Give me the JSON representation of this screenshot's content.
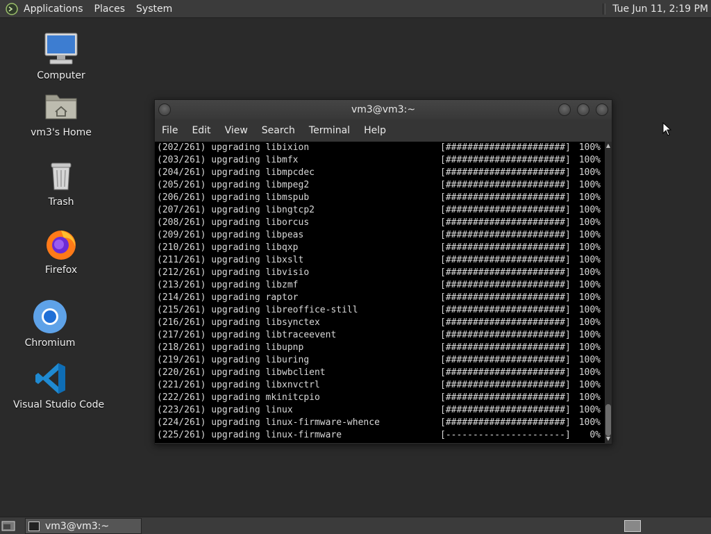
{
  "top_panel": {
    "menus": [
      "Applications",
      "Places",
      "System"
    ],
    "clock": "Tue Jun 11,  2:19 PM"
  },
  "desktop_icons": [
    {
      "label": "Computer",
      "icon": "computer-icon"
    },
    {
      "label": "vm3's Home",
      "icon": "home-folder-icon"
    },
    {
      "label": "Trash",
      "icon": "trash-icon"
    },
    {
      "label": "Firefox",
      "icon": "firefox-icon"
    },
    {
      "label": "Chromium",
      "icon": "chromium-icon"
    },
    {
      "label": "Visual Studio Code",
      "icon": "vscode-icon"
    }
  ],
  "terminal": {
    "title": "vm3@vm3:~",
    "menu": [
      "File",
      "Edit",
      "View",
      "Search",
      "Terminal",
      "Help"
    ],
    "lines": [
      {
        "text": "(202/261) upgrading libixion",
        "bar": "[######################]",
        "pct": "100%"
      },
      {
        "text": "(203/261) upgrading libmfx",
        "bar": "[######################]",
        "pct": "100%"
      },
      {
        "text": "(204/261) upgrading libmpcdec",
        "bar": "[######################]",
        "pct": "100%"
      },
      {
        "text": "(205/261) upgrading libmpeg2",
        "bar": "[######################]",
        "pct": "100%"
      },
      {
        "text": "(206/261) upgrading libmspub",
        "bar": "[######################]",
        "pct": "100%"
      },
      {
        "text": "(207/261) upgrading libngtcp2",
        "bar": "[######################]",
        "pct": "100%"
      },
      {
        "text": "(208/261) upgrading liborcus",
        "bar": "[######################]",
        "pct": "100%"
      },
      {
        "text": "(209/261) upgrading libpeas",
        "bar": "[######################]",
        "pct": "100%"
      },
      {
        "text": "(210/261) upgrading libqxp",
        "bar": "[######################]",
        "pct": "100%"
      },
      {
        "text": "(211/261) upgrading libxslt",
        "bar": "[######################]",
        "pct": "100%"
      },
      {
        "text": "(212/261) upgrading libvisio",
        "bar": "[######################]",
        "pct": "100%"
      },
      {
        "text": "(213/261) upgrading libzmf",
        "bar": "[######################]",
        "pct": "100%"
      },
      {
        "text": "(214/261) upgrading raptor",
        "bar": "[######################]",
        "pct": "100%"
      },
      {
        "text": "(215/261) upgrading libreoffice-still",
        "bar": "[######################]",
        "pct": "100%"
      },
      {
        "text": "(216/261) upgrading libsynctex",
        "bar": "[######################]",
        "pct": "100%"
      },
      {
        "text": "(217/261) upgrading libtraceevent",
        "bar": "[######################]",
        "pct": "100%"
      },
      {
        "text": "(218/261) upgrading libupnp",
        "bar": "[######################]",
        "pct": "100%"
      },
      {
        "text": "(219/261) upgrading liburing",
        "bar": "[######################]",
        "pct": "100%"
      },
      {
        "text": "(220/261) upgrading libwbclient",
        "bar": "[######################]",
        "pct": "100%"
      },
      {
        "text": "(221/261) upgrading libxnvctrl",
        "bar": "[######################]",
        "pct": "100%"
      },
      {
        "text": "(222/261) upgrading mkinitcpio",
        "bar": "[######################]",
        "pct": "100%"
      },
      {
        "text": "(223/261) upgrading linux",
        "bar": "[######################]",
        "pct": "100%"
      },
      {
        "text": "(224/261) upgrading linux-firmware-whence",
        "bar": "[######################]",
        "pct": "100%"
      },
      {
        "text": "(225/261) upgrading linux-firmware",
        "bar": "[----------------------]",
        "pct": "0%"
      }
    ]
  },
  "taskbar": {
    "task_label": "vm3@vm3:~"
  }
}
